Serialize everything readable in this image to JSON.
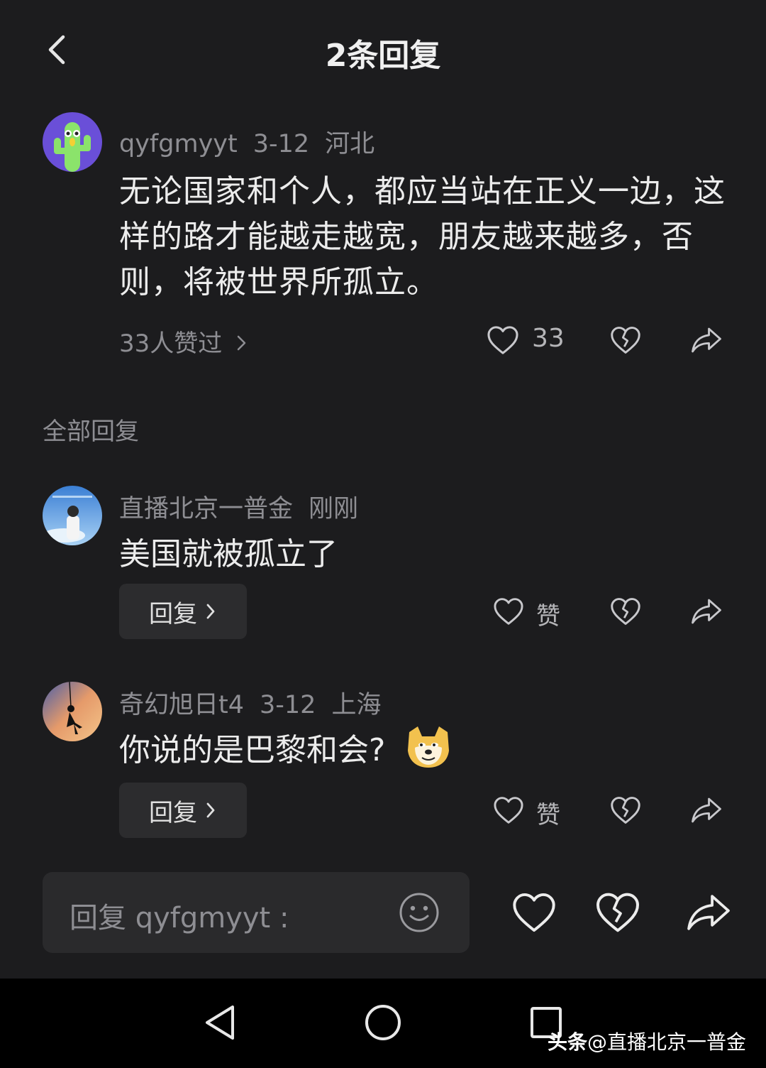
{
  "header": {
    "title": "2条回复"
  },
  "main_comment": {
    "username": "qyfgmyyt",
    "date": "3-12",
    "location": "河北",
    "text": "无论国家和个人，都应当站在正义一边，这样的路才能越走越宽，朋友越来越多，否则，将被世界所孤立。",
    "likes_summary": "33人赞过",
    "like_count": "33"
  },
  "section_label": "全部回复",
  "replies": [
    {
      "username": "直播北京一普金",
      "time": "刚刚",
      "location": "",
      "text": "美国就被孤立了",
      "reply_label": "回复",
      "like_label": "赞"
    },
    {
      "username": "奇幻旭日t4",
      "time": "3-12",
      "location": "上海",
      "text": "你说的是巴黎和会?",
      "emoji": "doge-emoji",
      "reply_label": "回复",
      "like_label": "赞"
    }
  ],
  "bottom_bar": {
    "placeholder": "回复 qyfgmyyt :"
  },
  "watermark": {
    "brand": "头条",
    "handle": "@直播北京一普金"
  },
  "colors": {
    "background": "#1c1c1e",
    "text": "#ececec",
    "muted": "#8e8e93",
    "button_bg": "#2c2c2e",
    "nav_bg": "#000000"
  }
}
